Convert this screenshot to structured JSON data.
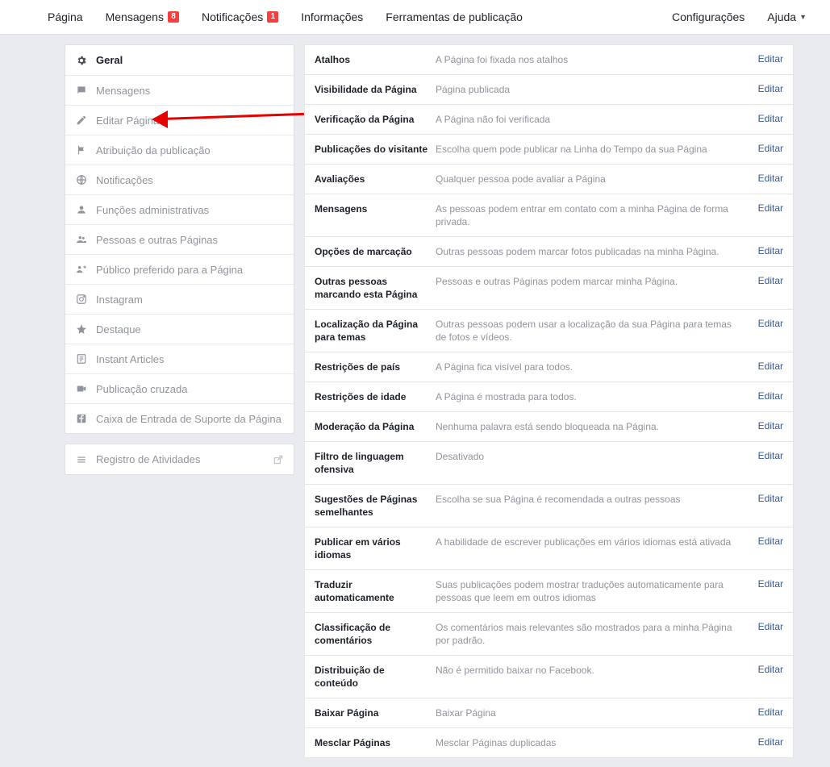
{
  "topnav": {
    "left": [
      {
        "label": "Página",
        "badge": null
      },
      {
        "label": "Mensagens",
        "badge": "8"
      },
      {
        "label": "Notificações",
        "badge": "1"
      },
      {
        "label": "Informações",
        "badge": null
      },
      {
        "label": "Ferramentas de publicação",
        "badge": null
      }
    ],
    "right": [
      {
        "label": "Configurações",
        "caret": false
      },
      {
        "label": "Ajuda",
        "caret": true
      }
    ]
  },
  "sidebar": {
    "items": [
      {
        "label": "Geral",
        "icon": "gear-icon",
        "active": true
      },
      {
        "label": "Mensagens",
        "icon": "speech-icon"
      },
      {
        "label": "Editar Página",
        "icon": "pencil-icon"
      },
      {
        "label": "Atribuição da publicação",
        "icon": "flag-icon"
      },
      {
        "label": "Notificações",
        "icon": "globe-icon"
      },
      {
        "label": "Funções administrativas",
        "icon": "person-icon"
      },
      {
        "label": "Pessoas e outras Páginas",
        "icon": "people-icon"
      },
      {
        "label": "Público preferido para a Página",
        "icon": "target-audience-icon"
      },
      {
        "label": "Instagram",
        "icon": "instagram-icon"
      },
      {
        "label": "Destaque",
        "icon": "star-icon"
      },
      {
        "label": "Instant Articles",
        "icon": "article-icon"
      },
      {
        "label": "Publicação cruzada",
        "icon": "video-icon"
      },
      {
        "label": "Caixa de Entrada de Suporte da Página",
        "icon": "facebook-icon"
      }
    ],
    "activity": {
      "label": "Registro de Atividades",
      "icon": "list-icon"
    }
  },
  "settings": {
    "edit_label": "Editar",
    "rows": [
      {
        "label": "Atalhos",
        "desc": "A Página foi fixada nos atalhos"
      },
      {
        "label": "Visibilidade da Página",
        "desc": "Página publicada"
      },
      {
        "label": "Verificação da Página",
        "desc": "A Página não foi verificada"
      },
      {
        "label": "Publicações do visitante",
        "desc": "Escolha quem pode publicar na Linha do Tempo da sua Página"
      },
      {
        "label": "Avaliações",
        "desc": "Qualquer pessoa pode avaliar a Página"
      },
      {
        "label": "Mensagens",
        "desc": "As pessoas podem entrar em contato com a minha Página de forma privada."
      },
      {
        "label": "Opções de marcação",
        "desc": "Outras pessoas podem marcar fotos publicadas na minha Página."
      },
      {
        "label": "Outras pessoas marcando esta Página",
        "desc": "Pessoas e outras Páginas podem marcar minha Página."
      },
      {
        "label": "Localização da Página para temas",
        "desc": "Outras pessoas podem usar a localização da sua Página para temas de fotos e vídeos."
      },
      {
        "label": "Restrições de país",
        "desc": "A Página fica visível para todos."
      },
      {
        "label": "Restrições de idade",
        "desc": "A Página é mostrada para todos."
      },
      {
        "label": "Moderação da Página",
        "desc": "Nenhuma palavra está sendo bloqueada na Página."
      },
      {
        "label": "Filtro de linguagem ofensiva",
        "desc": "Desativado"
      },
      {
        "label": "Sugestões de Páginas semelhantes",
        "desc": "Escolha se sua Página é recomendada a outras pessoas"
      },
      {
        "label": "Publicar em vários idiomas",
        "desc": "A habilidade de escrever publicações em vários idiomas está ativada"
      },
      {
        "label": "Traduzir automaticamente",
        "desc": "Suas publicações podem mostrar traduções automaticamente para pessoas que leem em outros idiomas"
      },
      {
        "label": "Classificação de comentários",
        "desc": "Os comentários mais relevantes são mostrados para a minha Página por padrão."
      },
      {
        "label": "Distribuição de conteúdo",
        "desc": "Não é permitido baixar no Facebook."
      },
      {
        "label": "Baixar Página",
        "desc": "Baixar Página"
      },
      {
        "label": "Mesclar Páginas",
        "desc": "Mesclar Páginas duplicadas"
      }
    ]
  }
}
